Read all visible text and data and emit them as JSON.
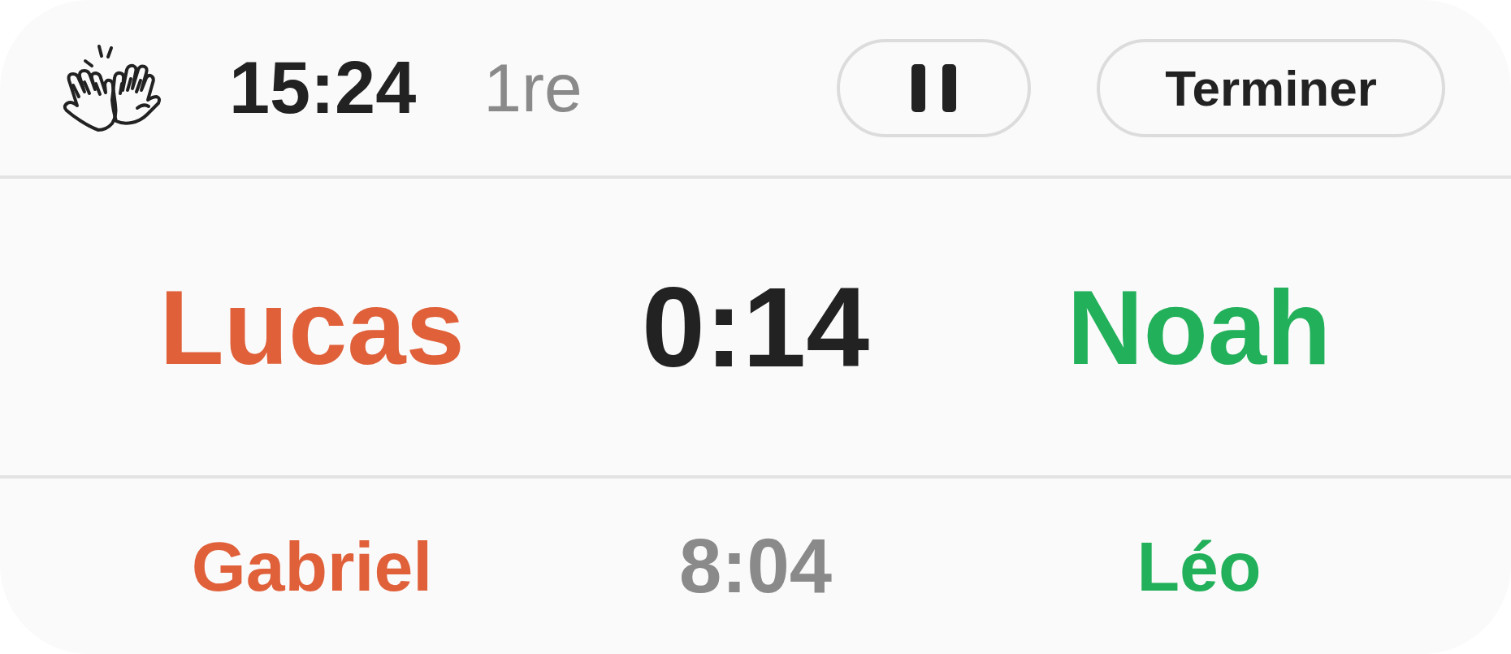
{
  "header": {
    "clock": "15:24",
    "period": "1re",
    "buttons": [
      {
        "kind": "pause"
      },
      {
        "kind": "text",
        "label": "Terminer"
      }
    ]
  },
  "matches": [
    {
      "active": true,
      "time": "0:14",
      "players": [
        {
          "name": "Lucas",
          "color": "#e0603a"
        },
        {
          "name": "Noah",
          "color": "#22b05a"
        }
      ]
    },
    {
      "active": false,
      "time": "8:04",
      "players": [
        {
          "name": "Gabriel",
          "color": "#e0603a"
        },
        {
          "name": "Léo",
          "color": "#22b05a"
        }
      ]
    }
  ]
}
